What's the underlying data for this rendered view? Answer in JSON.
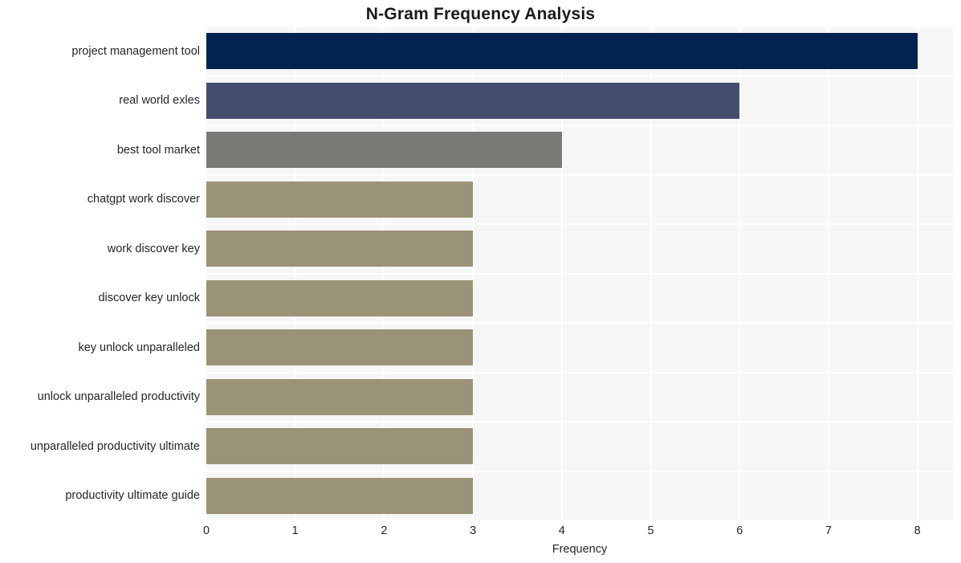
{
  "chart_data": {
    "type": "bar",
    "orientation": "horizontal",
    "title": "N-Gram Frequency Analysis",
    "xlabel": "Frequency",
    "ylabel": "",
    "categories": [
      "project management tool",
      "real world exles",
      "best tool market",
      "chatgpt work discover",
      "work discover key",
      "discover key unlock",
      "key unlock unparalleled",
      "unlock unparalleled productivity",
      "unparalleled productivity ultimate",
      "productivity ultimate guide"
    ],
    "values": [
      8,
      6,
      4,
      3,
      3,
      3,
      3,
      3,
      3,
      3
    ],
    "bar_colors": [
      "#002350",
      "#444d6e",
      "#7b7976",
      "#9a9375",
      "#9a9375",
      "#9a9375",
      "#9a9375",
      "#9a9375",
      "#9a9375",
      "#9a9375"
    ],
    "xlim": [
      0,
      8.4
    ],
    "xticks": [
      0,
      1,
      2,
      3,
      4,
      5,
      6,
      7,
      8
    ],
    "xtick_labels": [
      "0",
      "1",
      "2",
      "3",
      "4",
      "5",
      "6",
      "7",
      "8"
    ],
    "grid": true,
    "grid_color": "#ffffff",
    "plot_background": "#f6f6f6",
    "figure_background": "#ffffff",
    "legend": null
  }
}
